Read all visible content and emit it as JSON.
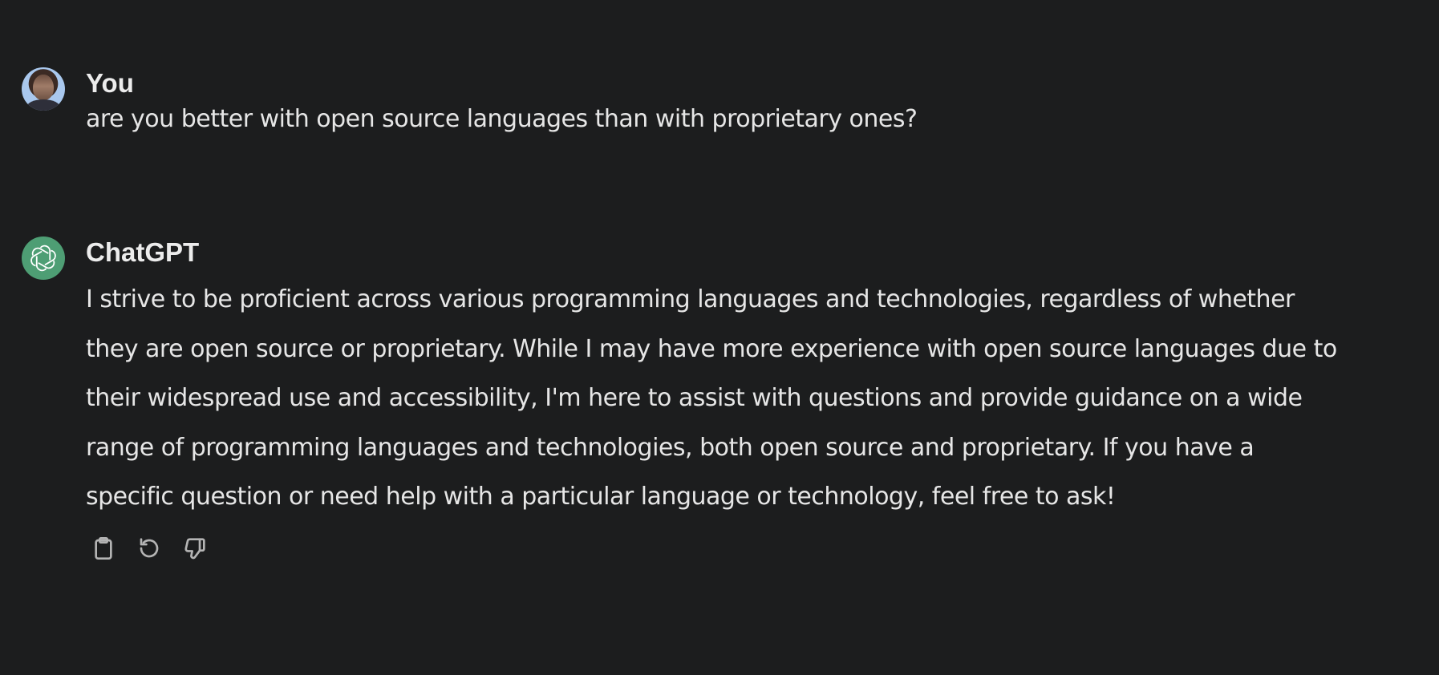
{
  "conversation": {
    "user_message": {
      "author": "You",
      "avatar_icon": "user-avatar-photo",
      "text": "are you better with open source languages than with proprietary ones?"
    },
    "assistant_message": {
      "author": "ChatGPT",
      "avatar_icon": "openai-logo-icon",
      "avatar_color": "#4e9e74",
      "text": "I strive to be proficient across various programming languages and technologies, regardless of whether they are open source or proprietary. While I may have more experience with open source languages due to their widespread use and accessibility, I'm here to assist with questions and provide guidance on a wide range of programming languages and technologies, both open source and proprietary. If you have a specific question or need help with a particular language or technology, feel free to ask!",
      "actions": [
        {
          "icon": "clipboard-icon"
        },
        {
          "icon": "regenerate-icon"
        },
        {
          "icon": "thumbs-down-icon"
        }
      ]
    }
  },
  "colors": {
    "background": "#1c1d1e",
    "text": "#e6e6e6",
    "icon": "#b4b4b4"
  }
}
